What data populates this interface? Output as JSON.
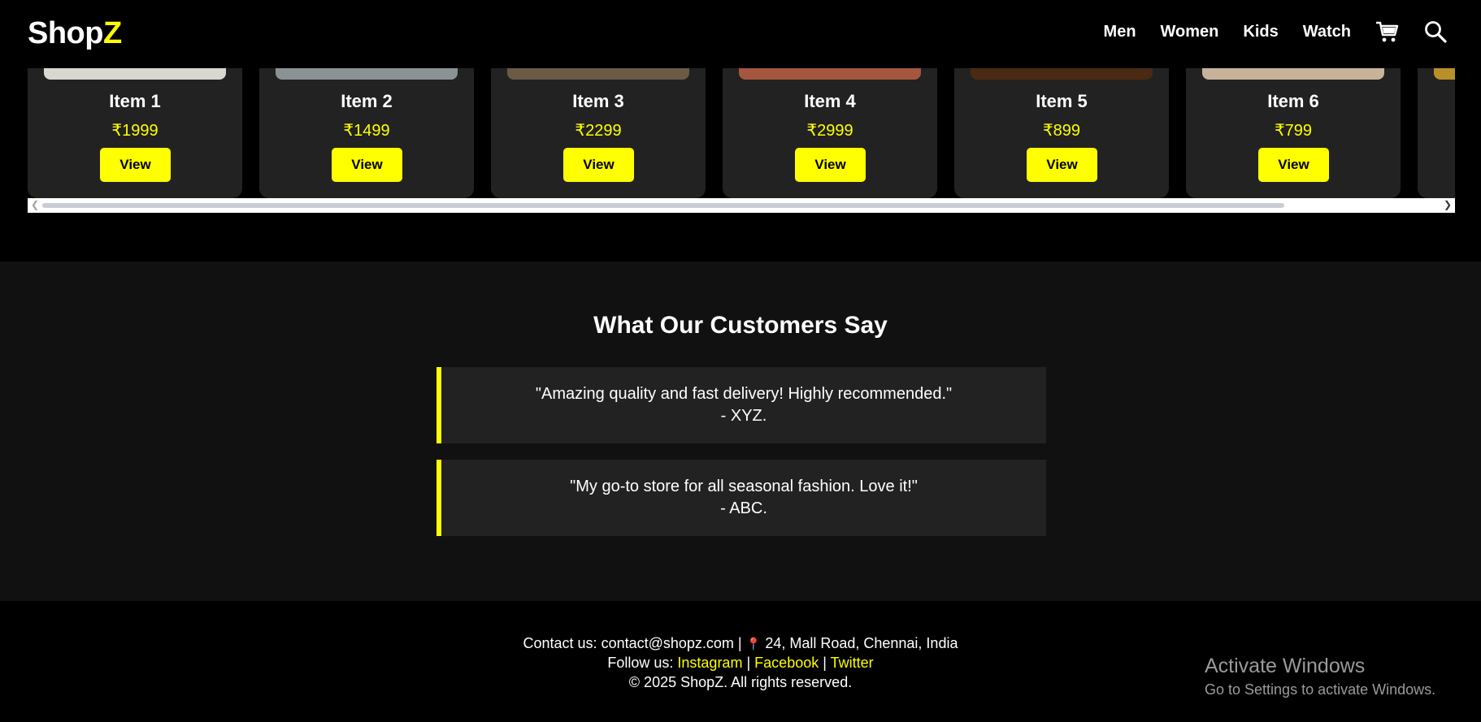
{
  "header": {
    "logo_main": "Shop",
    "logo_accent": "Z",
    "nav": [
      "Men",
      "Women",
      "Kids",
      "Watch"
    ],
    "icons": [
      "cart-icon",
      "search-icon"
    ]
  },
  "products": [
    {
      "name": "Item 1",
      "price": "₹1999",
      "button": "View",
      "image_color": "#d8d8d0"
    },
    {
      "name": "Item 2",
      "price": "₹1499",
      "button": "View",
      "image_color": "#8a9294"
    },
    {
      "name": "Item 3",
      "price": "₹2299",
      "button": "View",
      "image_color": "#6b5a44"
    },
    {
      "name": "Item 4",
      "price": "₹2999",
      "button": "View",
      "image_color": "#a4563e"
    },
    {
      "name": "Item 5",
      "price": "₹899",
      "button": "View",
      "image_color": "#4a2a12"
    },
    {
      "name": "Item 6",
      "price": "₹799",
      "button": "View",
      "image_color": "#c7b39a"
    }
  ],
  "testimonials": {
    "heading": "What Our Customers Say",
    "items": [
      {
        "quote": "\"Amazing quality and fast delivery! Highly recommended.\"",
        "author": "- XYZ."
      },
      {
        "quote": "\"My go-to store for all seasonal fashion. Love it!\"",
        "author": "- ABC."
      }
    ]
  },
  "footer": {
    "contact_prefix": "Contact us: contact@shopz.com |",
    "location_icon": "📍",
    "address": "24, Mall Road, Chennai, India",
    "follow_prefix": "Follow us:",
    "social": [
      "Instagram",
      "Facebook",
      "Twitter"
    ],
    "separator": "|",
    "copyright": "© 2025 ShopZ. All rights reserved."
  },
  "watermark": {
    "title": "Activate Windows",
    "subtitle": "Go to Settings to activate Windows."
  },
  "colors": {
    "accent": "#ffff00",
    "background": "#000000",
    "section_bg": "#111111",
    "card_bg": "#222222"
  }
}
